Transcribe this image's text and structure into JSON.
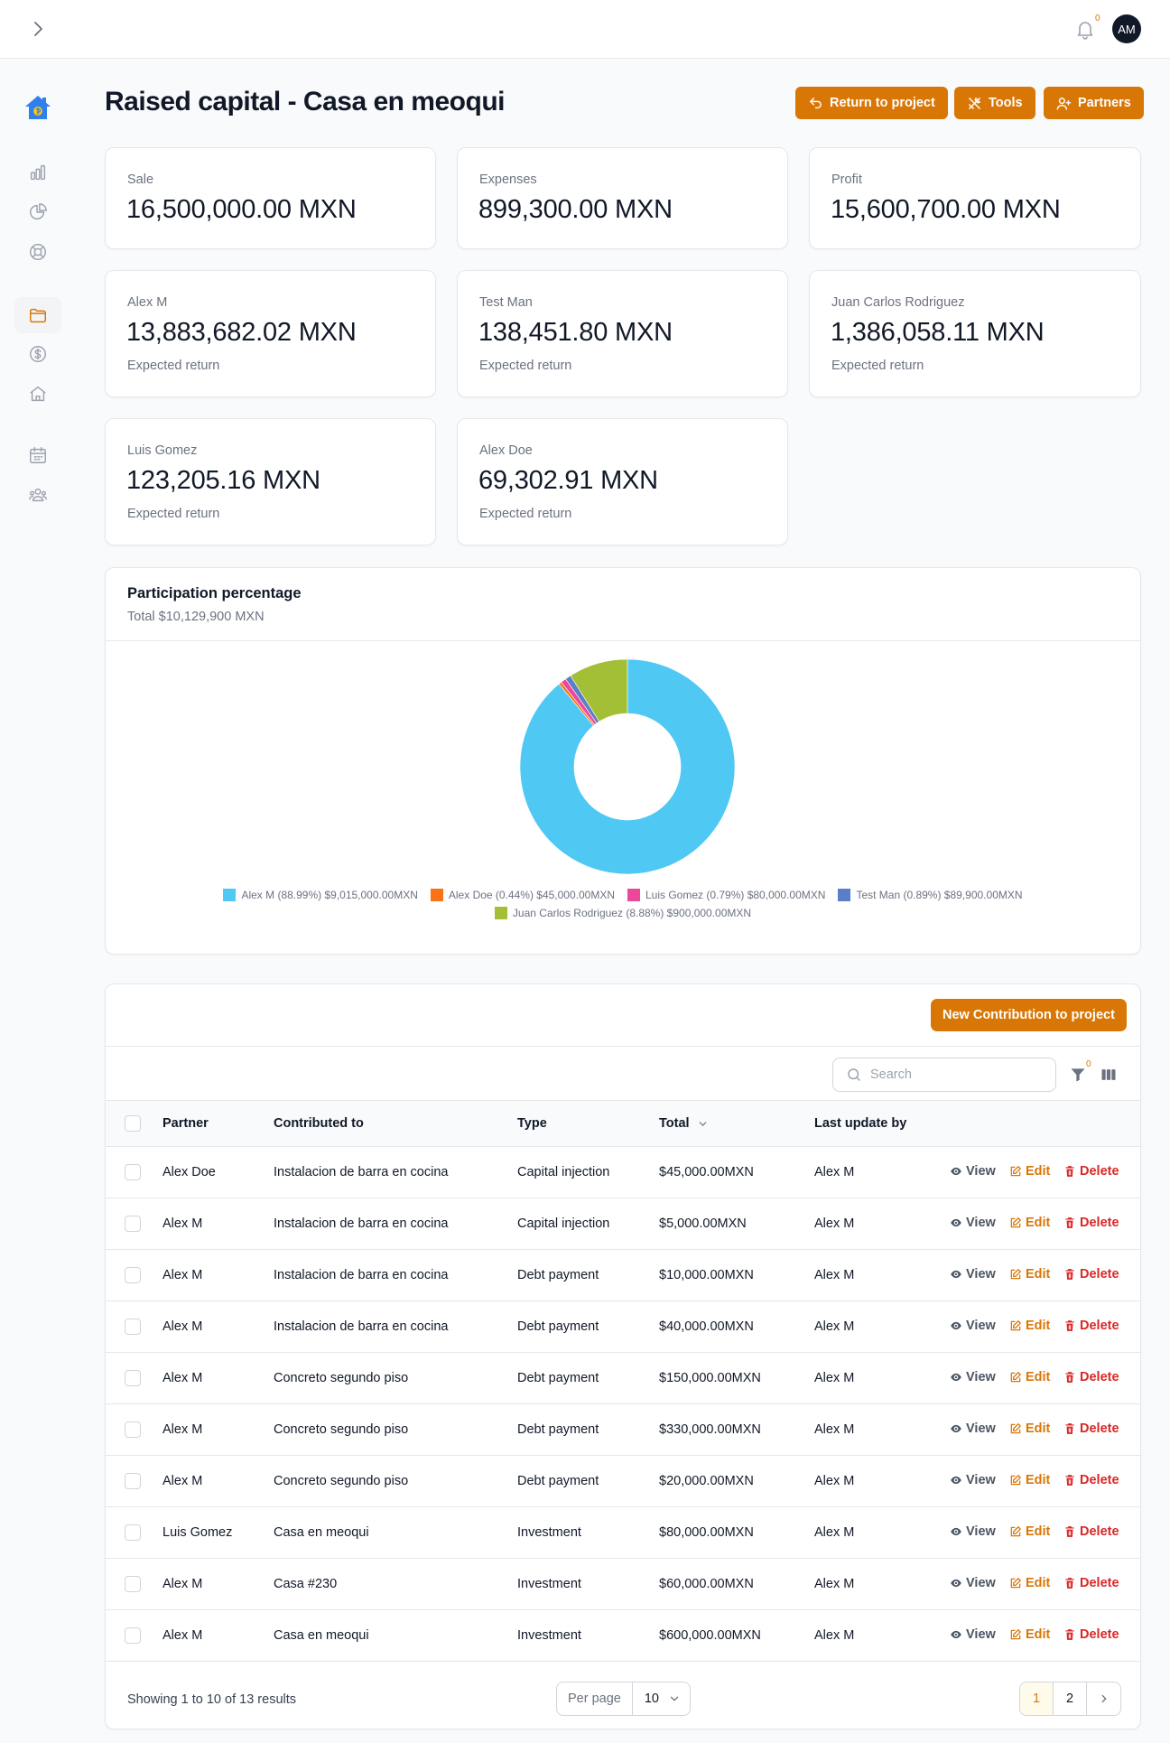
{
  "topbar": {
    "notifications_count": "0",
    "avatar_initials": "AM"
  },
  "sidebar": {
    "items": [
      {
        "icon": "bar-chart-icon",
        "active": false
      },
      {
        "icon": "pie-chart-icon",
        "active": false
      },
      {
        "icon": "lifebuoy-icon",
        "active": false
      },
      {
        "icon": "folder-icon",
        "active": true
      },
      {
        "icon": "dollar-circle-icon",
        "active": false
      },
      {
        "icon": "home-icon",
        "active": false
      },
      {
        "icon": "calendar-icon",
        "active": false
      },
      {
        "icon": "users-icon",
        "active": false
      }
    ]
  },
  "page": {
    "title": "Raised capital - Casa en meoqui",
    "buttons": {
      "return": "Return to project",
      "tools": "Tools",
      "partners": "Partners"
    }
  },
  "summary": [
    {
      "label": "Sale",
      "value": "16,500,000.00 MXN"
    },
    {
      "label": "Expenses",
      "value": "899,300.00 MXN"
    },
    {
      "label": "Profit",
      "value": "15,600,700.00 MXN"
    }
  ],
  "partner_cards": [
    {
      "name": "Alex M",
      "value": "13,883,682.02 MXN",
      "sub": "Expected return"
    },
    {
      "name": "Test Man",
      "value": "138,451.80 MXN",
      "sub": "Expected return"
    },
    {
      "name": "Juan Carlos Rodriguez",
      "value": "1,386,058.11 MXN",
      "sub": "Expected return"
    },
    {
      "name": "Luis Gomez",
      "value": "123,205.16 MXN",
      "sub": "Expected return"
    },
    {
      "name": "Alex Doe",
      "value": "69,302.91 MXN",
      "sub": "Expected return"
    }
  ],
  "chart_card": {
    "title": "Participation percentage",
    "subtitle": "Total $10,129,900 MXN"
  },
  "chart_data": {
    "type": "pie",
    "donut": true,
    "title": "Participation percentage",
    "slices": [
      {
        "name": "Alex M",
        "value": 9015000,
        "percent": 88.99,
        "color": "#4fc8f4",
        "label": "Alex M (88.99%) $9,015,000.00MXN"
      },
      {
        "name": "Alex Doe",
        "value": 45000,
        "percent": 0.44,
        "color": "#f97316",
        "label": "Alex Doe (0.44%) $45,000.00MXN"
      },
      {
        "name": "Luis Gomez",
        "value": 80000,
        "percent": 0.79,
        "color": "#ec4899",
        "label": "Luis Gomez (0.79%) $80,000.00MXN"
      },
      {
        "name": "Test Man",
        "value": 89900,
        "percent": 0.89,
        "color": "#5b7fc7",
        "label": "Test Man (0.89%) $89,900.00MXN"
      },
      {
        "name": "Juan Carlos Rodriguez",
        "value": 900000,
        "percent": 8.88,
        "color": "#a3bf35",
        "label": "Juan Carlos Rodriguez (8.88%) $900,000.00MXN"
      }
    ],
    "legend_position": "bottom"
  },
  "table": {
    "new_button": "New Contribution to project",
    "search_placeholder": "Search",
    "filter_count": "0",
    "columns": [
      "Partner",
      "Contributed to",
      "Type",
      "Total",
      "Last update by"
    ],
    "sorted_column": "Total",
    "actions": {
      "view": "View",
      "edit": "Edit",
      "delete": "Delete"
    },
    "rows": [
      {
        "partner": "Alex Doe",
        "contributed_to": "Instalacion de barra en cocina",
        "type": "Capital injection",
        "total": "$45,000.00MXN",
        "updated_by": "Alex M"
      },
      {
        "partner": "Alex M",
        "contributed_to": "Instalacion de barra en cocina",
        "type": "Capital injection",
        "total": "$5,000.00MXN",
        "updated_by": "Alex M"
      },
      {
        "partner": "Alex M",
        "contributed_to": "Instalacion de barra en cocina",
        "type": "Debt payment",
        "total": "$10,000.00MXN",
        "updated_by": "Alex M"
      },
      {
        "partner": "Alex M",
        "contributed_to": "Instalacion de barra en cocina",
        "type": "Debt payment",
        "total": "$40,000.00MXN",
        "updated_by": "Alex M"
      },
      {
        "partner": "Alex M",
        "contributed_to": "Concreto segundo piso",
        "type": "Debt payment",
        "total": "$150,000.00MXN",
        "updated_by": "Alex M"
      },
      {
        "partner": "Alex M",
        "contributed_to": "Concreto segundo piso",
        "type": "Debt payment",
        "total": "$330,000.00MXN",
        "updated_by": "Alex M"
      },
      {
        "partner": "Alex M",
        "contributed_to": "Concreto segundo piso",
        "type": "Debt payment",
        "total": "$20,000.00MXN",
        "updated_by": "Alex M"
      },
      {
        "partner": "Luis Gomez",
        "contributed_to": "Casa en meoqui",
        "type": "Investment",
        "total": "$80,000.00MXN",
        "updated_by": "Alex M"
      },
      {
        "partner": "Alex M",
        "contributed_to": "Casa #230",
        "type": "Investment",
        "total": "$60,000.00MXN",
        "updated_by": "Alex M"
      },
      {
        "partner": "Alex M",
        "contributed_to": "Casa en meoqui",
        "type": "Investment",
        "total": "$600,000.00MXN",
        "updated_by": "Alex M"
      }
    ],
    "footer": {
      "showing": "Showing 1 to 10 of 13 results",
      "per_page_label": "Per page",
      "per_page_value": "10",
      "pages": [
        "1",
        "2"
      ],
      "current_page": "1"
    }
  }
}
